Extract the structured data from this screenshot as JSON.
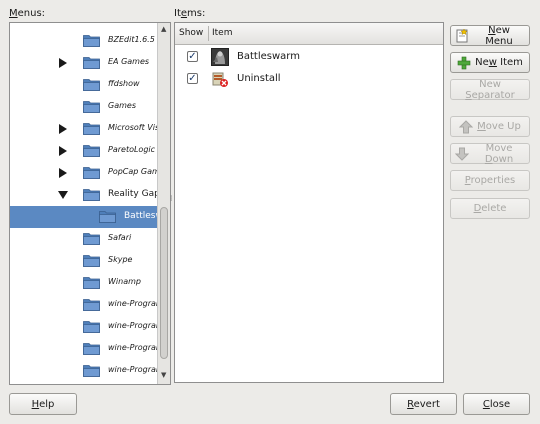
{
  "menus_label": {
    "u": "M",
    "rest": "enus:"
  },
  "items_label": {
    "pre": "It",
    "u": "e",
    "rest": "ms:"
  },
  "tree": [
    {
      "label": "BZEdit1.6.5",
      "expander": "none",
      "level": 1,
      "style": "italic",
      "selected": false
    },
    {
      "label": "EA Games",
      "expander": "collapsed",
      "level": 1,
      "style": "italic",
      "selected": false
    },
    {
      "label": "ffdshow",
      "expander": "none",
      "level": 1,
      "style": "italic",
      "selected": false
    },
    {
      "label": "Games",
      "expander": "none",
      "level": 1,
      "style": "italic",
      "selected": false
    },
    {
      "label": "Microsoft Visual S",
      "expander": "collapsed",
      "level": 1,
      "style": "italic",
      "selected": false
    },
    {
      "label": "ParetoLogic",
      "expander": "collapsed",
      "level": 1,
      "style": "italic",
      "selected": false
    },
    {
      "label": "PopCap Games",
      "expander": "collapsed",
      "level": 1,
      "style": "italic",
      "selected": false
    },
    {
      "label": "Reality Gap",
      "expander": "expanded",
      "level": 1,
      "style": "plain",
      "selected": false
    },
    {
      "label": "Battleswa",
      "expander": "none",
      "level": 2,
      "style": "plain",
      "selected": true
    },
    {
      "label": "Safari",
      "expander": "none",
      "level": 1,
      "style": "italic",
      "selected": false
    },
    {
      "label": "Skype",
      "expander": "none",
      "level": 1,
      "style": "italic",
      "selected": false
    },
    {
      "label": "Winamp",
      "expander": "none",
      "level": 1,
      "style": "italic",
      "selected": false
    },
    {
      "label": "wine-Programs-...",
      "expander": "none",
      "level": 1,
      "style": "italic",
      "selected": false
    },
    {
      "label": "wine-Programs-T",
      "expander": "none",
      "level": 1,
      "style": "italic",
      "selected": false
    },
    {
      "label": "wine-Programs-V",
      "expander": "none",
      "level": 1,
      "style": "italic",
      "selected": false
    },
    {
      "label": "wine-Programs-X",
      "expander": "none",
      "level": 1,
      "style": "italic",
      "selected": false
    }
  ],
  "items": {
    "headers": {
      "show": "Show",
      "item": "Item"
    },
    "rows": [
      {
        "label": "Battleswarm",
        "checked": true,
        "icon": "battleswarm-icon"
      },
      {
        "label": "Uninstall",
        "checked": true,
        "icon": "uninstall-icon"
      }
    ]
  },
  "buttons": {
    "new_menu": {
      "u": "N",
      "rest": "ew Menu",
      "icon": "new-menu-icon",
      "enabled": true
    },
    "new_item": {
      "pre": "Ne",
      "u": "w",
      "rest": " Item",
      "icon": "new-item-icon",
      "enabled": true
    },
    "new_separator": {
      "pre": "New ",
      "u": "S",
      "rest": "eparator",
      "enabled": false
    },
    "move_up": {
      "u": "M",
      "rest": "ove Up",
      "icon": "arrow-up-icon",
      "enabled": false
    },
    "move_down": {
      "pre": "Move ",
      "u": "D",
      "rest": "own",
      "icon": "arrow-down-icon",
      "enabled": false
    },
    "properties": {
      "u": "P",
      "rest": "roperties",
      "enabled": false
    },
    "delete": {
      "u": "D",
      "rest": "elete",
      "enabled": false
    },
    "help": {
      "u": "H",
      "rest": "elp"
    },
    "revert": {
      "u": "R",
      "rest": "evert"
    },
    "close": {
      "u": "C",
      "rest": "lose"
    }
  },
  "colors": {
    "selection": "#5b89c2",
    "folder": "#5f8fc9",
    "window_bg": "#ecebe8"
  }
}
